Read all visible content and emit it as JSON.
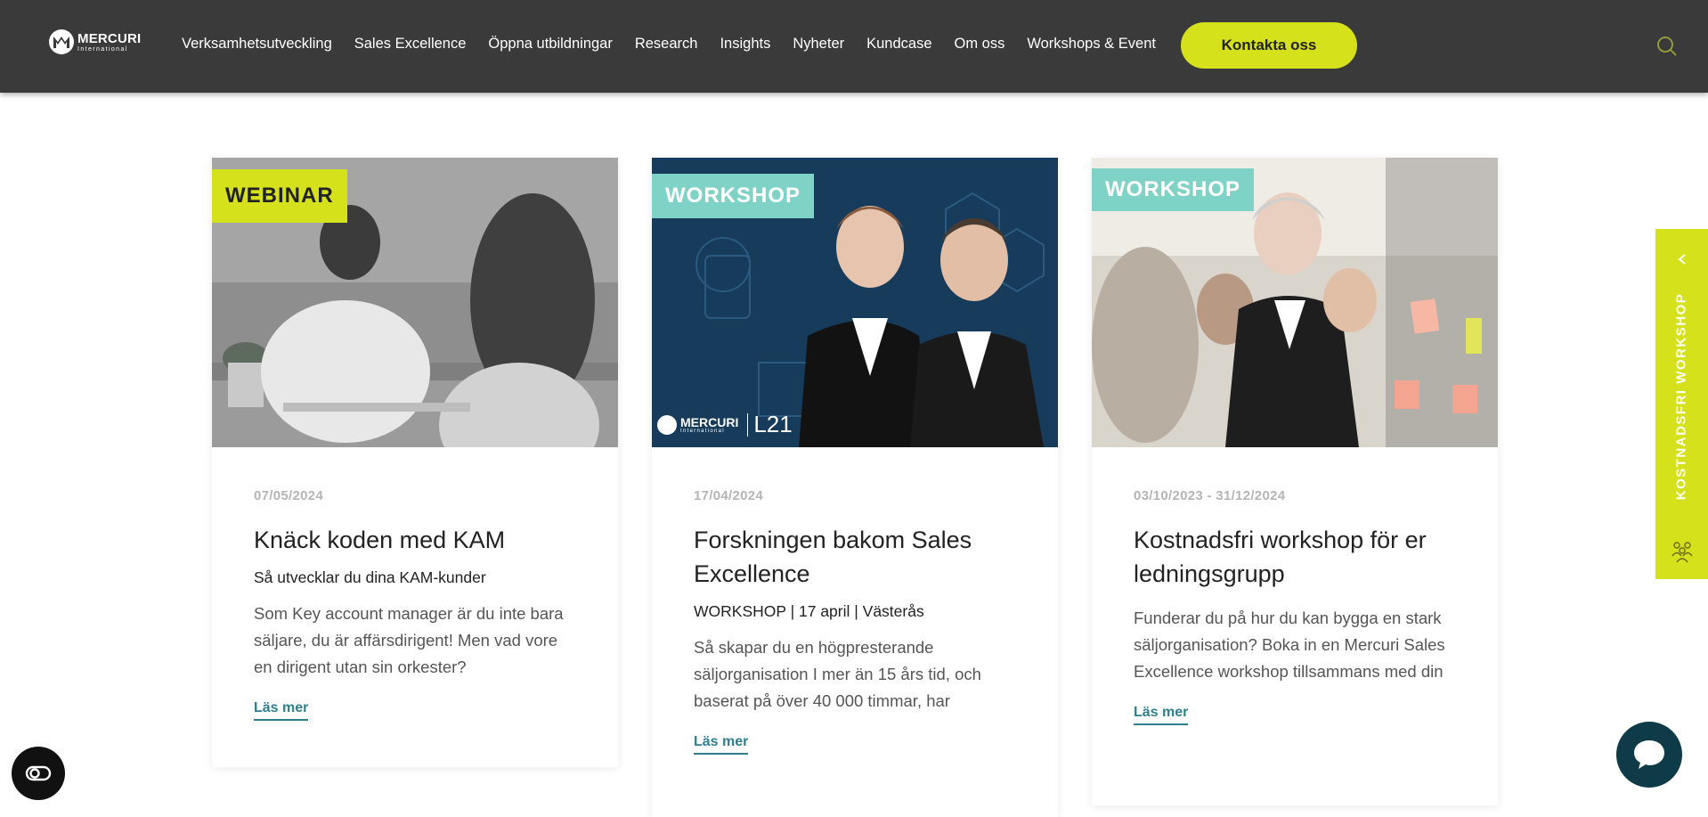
{
  "header": {
    "logo": {
      "line1": "MERCURI",
      "line2": "International"
    },
    "nav": [
      "Verksamhetsutveckling",
      "Sales Excellence",
      "Öppna utbildningar",
      "Research",
      "Insights",
      "Nyheter",
      "Kundcase",
      "Om oss",
      "Workshops & Event"
    ],
    "cta": "Kontakta oss",
    "search_icon": "search-icon"
  },
  "cards": [
    {
      "badge": "WEBINAR",
      "date": "07/05/2024",
      "title": "Knäck koden med KAM",
      "subtitle": "Så utvecklar du dina KAM-kunder",
      "description": "Som Key account manager är du inte bara säljare, du är affärsdirigent! Men vad vore en dirigent utan sin orkester?",
      "link": "Läs mer"
    },
    {
      "badge": "WORKSHOP",
      "image_logo": "MERCURI",
      "image_logo_sub": "International",
      "image_tag": "L21",
      "date": "17/04/2024",
      "title": "Forskningen bakom Sales Excellence",
      "subtitle": "WORKSHOP | 17 april | Västerås",
      "description": "Så skapar du en högpresterande säljorganisation I mer än 15 års tid, och baserat på över 40 000 timmar, har",
      "link": "Läs mer"
    },
    {
      "badge": "WORKSHOP",
      "date": "03/10/2023 - 31/12/2024",
      "title": "Kostnadsfri workshop för er ledningsgrupp",
      "description": "Funderar du på hur du kan bygga en stark säljorganisation? Boka in en Mercuri Sales Excellence workshop tillsammans med din",
      "link": "Läs mer"
    }
  ],
  "side_tab": {
    "label": "KOSTNADSFRI WORKSHOP"
  },
  "colors": {
    "accent": "#d5e11a",
    "header_bg": "#3a3a3a",
    "link": "#2f7f8f",
    "badge_teal": "#7fd3c6",
    "chat": "#0f3a47"
  }
}
